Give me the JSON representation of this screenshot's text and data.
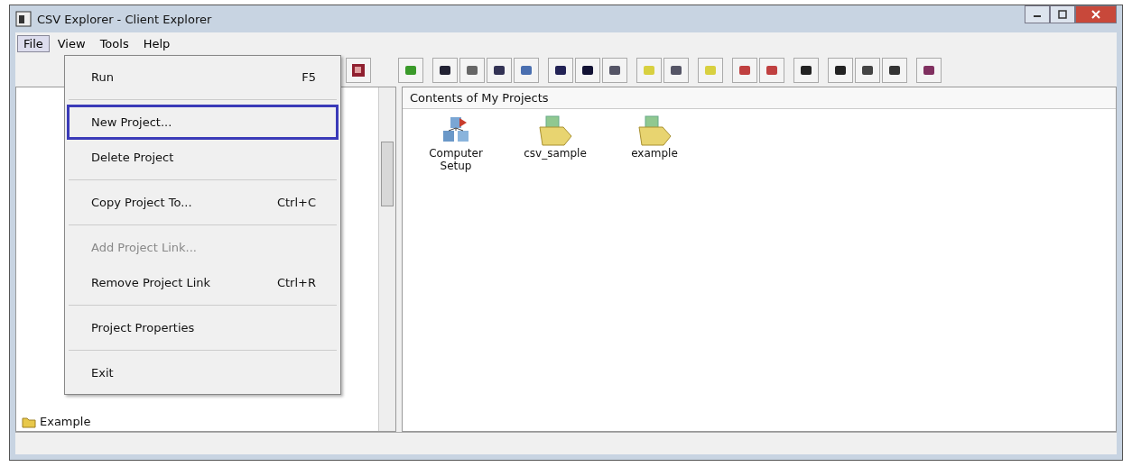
{
  "window": {
    "title": "CSV Explorer - Client Explorer"
  },
  "menu_bar": [
    {
      "label": "File",
      "selected": true
    },
    {
      "label": "View",
      "selected": false
    },
    {
      "label": "Tools",
      "selected": false
    },
    {
      "label": "Help",
      "selected": false
    }
  ],
  "file_menu": [
    {
      "label": "Run",
      "shortcut": "F5",
      "selected": false,
      "disabled": false,
      "separator_after": true
    },
    {
      "label": "New Project...",
      "selected": true,
      "disabled": false,
      "separator_after": false
    },
    {
      "label": "Delete Project",
      "selected": false,
      "disabled": false,
      "separator_after": true
    },
    {
      "label": "Copy Project To...",
      "shortcut": "Ctrl+C",
      "selected": false,
      "disabled": false,
      "separator_after": true
    },
    {
      "label": "Add Project Link...",
      "selected": false,
      "disabled": true,
      "separator_after": false
    },
    {
      "label": "Remove Project Link",
      "shortcut": "Ctrl+R",
      "selected": false,
      "disabled": false,
      "separator_after": true
    },
    {
      "label": "Project Properties",
      "selected": false,
      "disabled": false,
      "separator_after": true
    },
    {
      "label": "Exit",
      "selected": false,
      "disabled": false
    }
  ],
  "tree": {
    "items": [
      {
        "label": "Example",
        "selected": false
      }
    ]
  },
  "contents": {
    "header": "Contents of My Projects",
    "items": [
      {
        "label": "Computer Setup",
        "kind": "setup"
      },
      {
        "label": "csv_sample",
        "kind": "project"
      },
      {
        "label": "example",
        "kind": "project"
      }
    ]
  }
}
